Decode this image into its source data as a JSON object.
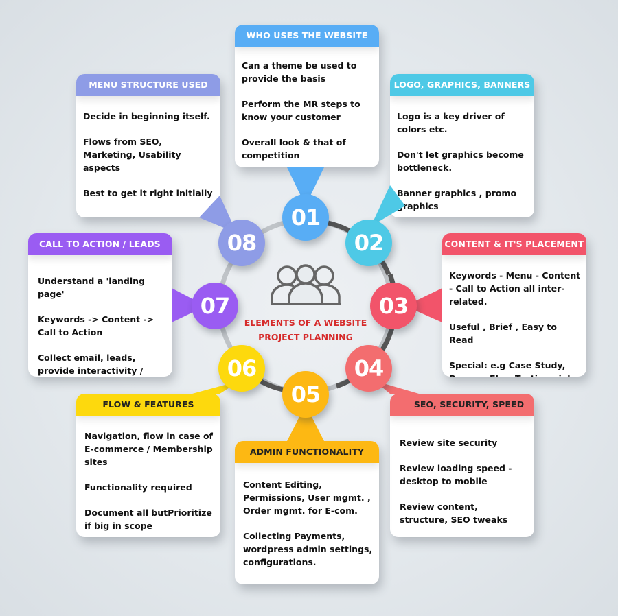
{
  "title": {
    "line1": "ELEMENTS OF A WEBSITE",
    "line2": "PROJECT PLANNING",
    "icon": "people-group-icon",
    "color": "#d62b2b"
  },
  "steps": [
    {
      "number": "01",
      "color": "#58adf5",
      "heading": "WHO USES THE WEBSITE",
      "points": [
        "Can a theme be used to provide the basis",
        "Perform the MR steps to know your customer",
        "Overall look & that of competition"
      ]
    },
    {
      "number": "02",
      "color": "#4ec9e6",
      "heading": "LOGO, GRAPHICS, BANNERS",
      "points": [
        "Logo is a key driver of colors etc.",
        "Don't let graphics become bottleneck.",
        "Banner graphics , promo graphics"
      ]
    },
    {
      "number": "03",
      "color": "#f2546a",
      "heading": "CONTENT & IT'S PLACEMENT",
      "points": [
        "Keywords - Menu - Content - Call to Action  all inter-related.",
        "Useful , Brief , Easy to Read",
        "Special: e.g Case Study, Process Flow,Testimonials."
      ]
    },
    {
      "number": "04",
      "color": "#f36d6f",
      "heading": "SEO,  SECURITY, SPEED",
      "points": [
        "Review site security",
        "Review loading speed - desktop to mobile",
        "Review content, structure, SEO tweaks"
      ]
    },
    {
      "number": "05",
      "color": "#fdb813",
      "heading": "ADMIN FUNCTIONALITY",
      "points": [
        "Content Editing, Permissions, User mgmt. , Order mgmt. for E-com.",
        "Collecting Payments, wordpress admin settings, configurations."
      ]
    },
    {
      "number": "06",
      "color": "#fdd90d",
      "heading": "FLOW & FEATURES",
      "points": [
        "Navigation, flow in case of E-commerce / Membership sites",
        "Functionality required",
        "Document all butPrioritize if big in scope"
      ]
    },
    {
      "number": "07",
      "color": "#9a5cf2",
      "heading": "CALL TO ACTION / LEADS",
      "points": [
        "Understand a 'landing page'",
        "Keywords -> Content -> Call to Action",
        "Collect email, leads, provide interactivity / chat."
      ]
    },
    {
      "number": "08",
      "color": "#8e9ce6",
      "heading": "MENU STRUCTURE USED",
      "points": [
        "Decide in beginning itself.",
        "Flows from SEO, Marketing, Usability aspects",
        " Best to get it right initially"
      ]
    }
  ]
}
